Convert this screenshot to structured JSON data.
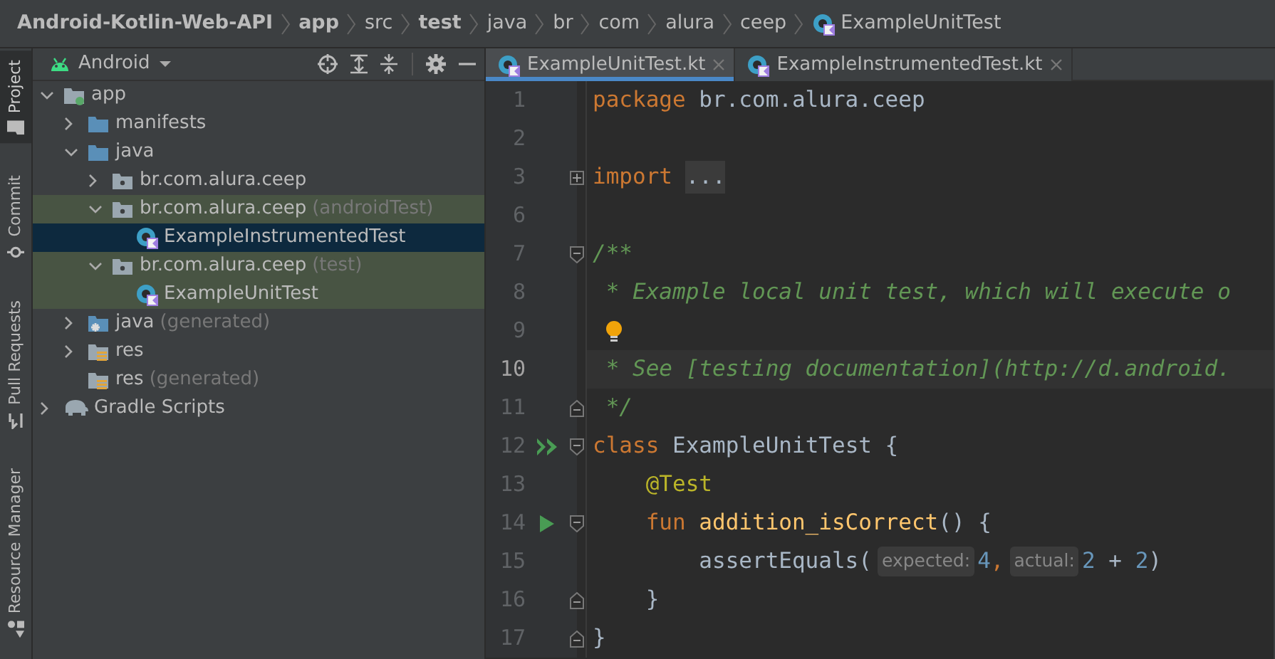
{
  "breadcrumbs": [
    {
      "text": "Android-Kotlin-Web-API",
      "kind": "module"
    },
    {
      "text": "app",
      "kind": "module"
    },
    {
      "text": "src",
      "kind": "dir"
    },
    {
      "text": "test",
      "kind": "module"
    },
    {
      "text": "java",
      "kind": "dir"
    },
    {
      "text": "br",
      "kind": "dir"
    },
    {
      "text": "com",
      "kind": "dir"
    },
    {
      "text": "alura",
      "kind": "dir"
    },
    {
      "text": "ceep",
      "kind": "dir"
    },
    {
      "text": "ExampleUnitTest",
      "kind": "class"
    }
  ],
  "tool_strip": [
    {
      "label": "Project",
      "kind": "folder",
      "selected": true
    },
    {
      "label": "Commit",
      "kind": "commit",
      "selected": false
    },
    {
      "label": "Pull Requests",
      "kind": "pull",
      "selected": false
    },
    {
      "label": "Resource Manager",
      "kind": "resources",
      "selected": false
    }
  ],
  "project_panel": {
    "view": "Android",
    "tree": [
      {
        "label": "app",
        "kind": "module",
        "expanded": true,
        "selected": false,
        "scope_highlight": false,
        "children": [
          {
            "label": "manifests",
            "kind": "folder",
            "expanded": false,
            "selected": false,
            "scope_highlight": false
          },
          {
            "label": "java",
            "kind": "folder",
            "expanded": true,
            "selected": false,
            "scope_highlight": false,
            "children": [
              {
                "label": "br.com.alura.ceep",
                "kind": "package",
                "expanded": false,
                "selected": false,
                "scope_highlight": false
              },
              {
                "label": "br.com.alura.ceep",
                "note": "(androidTest)",
                "kind": "package",
                "expanded": true,
                "selected": false,
                "scope_highlight": true,
                "children": [
                  {
                    "label": "ExampleInstrumentedTest",
                    "kind": "class",
                    "selected": true
                  }
                ]
              },
              {
                "label": "br.com.alura.ceep",
                "note": "(test)",
                "kind": "package",
                "expanded": true,
                "selected": false,
                "scope_highlight": true,
                "children": [
                  {
                    "label": "ExampleUnitTest",
                    "kind": "class",
                    "selected": false,
                    "scope_highlight": true
                  }
                ]
              }
            ]
          },
          {
            "label": "java",
            "note": "(generated)",
            "kind": "generated",
            "expanded": false,
            "selected": false,
            "scope_highlight": false
          },
          {
            "label": "res",
            "kind": "res",
            "expanded": false,
            "selected": false,
            "scope_highlight": false
          },
          {
            "label": "res",
            "note": "(generated)",
            "kind": "res",
            "selected": false,
            "scope_highlight": false
          }
        ]
      },
      {
        "label": "Gradle Scripts",
        "kind": "gradle",
        "expanded": false,
        "selected": false,
        "scope_highlight": false
      }
    ]
  },
  "editor_tabs": [
    {
      "label": "ExampleUnitTest.kt",
      "selected": true
    },
    {
      "label": "ExampleInstrumentedTest.kt",
      "selected": false
    }
  ],
  "code_lines": [
    {
      "number": "1",
      "highlighted": false,
      "bulb": false,
      "tokens": [
        {
          "kind": "keyword",
          "text": "package "
        },
        {
          "kind": "plain",
          "text": "br.com.alura.ceep"
        }
      ]
    },
    {
      "number": "2",
      "highlighted": false,
      "bulb": false
    },
    {
      "number": "3",
      "highlighted": false,
      "bulb": false,
      "fold_marker": {
        "kind": "folded"
      },
      "tokens": [
        {
          "kind": "keyword",
          "text": "import "
        },
        {
          "kind": "folded",
          "text": "..."
        }
      ]
    },
    {
      "number": "6",
      "highlighted": false,
      "bulb": false
    },
    {
      "number": "7",
      "highlighted": false,
      "bulb": false,
      "fold_marker": {
        "kind": "start"
      },
      "tokens": [
        {
          "kind": "comment",
          "text": "/**"
        }
      ]
    },
    {
      "number": "8",
      "highlighted": false,
      "bulb": false,
      "tokens": [
        {
          "kind": "comment",
          "text": " * Example local unit test, which will execute o"
        }
      ]
    },
    {
      "number": "9",
      "highlighted": false,
      "bulb": true
    },
    {
      "number": "10",
      "highlighted": true,
      "bulb": false,
      "tokens": [
        {
          "kind": "comment",
          "text": " * See [testing documentation](http://d.android."
        }
      ]
    },
    {
      "number": "11",
      "highlighted": false,
      "bulb": false,
      "fold_marker": {
        "kind": "end"
      },
      "tokens": [
        {
          "kind": "comment",
          "text": " */"
        }
      ]
    },
    {
      "number": "12",
      "highlighted": false,
      "bulb": false,
      "run_marker": {
        "kind": "run_all"
      },
      "fold_marker": {
        "kind": "start"
      },
      "tokens": [
        {
          "kind": "keyword",
          "text": "class "
        },
        {
          "kind": "plain",
          "text": "ExampleUnitTest {"
        }
      ]
    },
    {
      "number": "13",
      "highlighted": false,
      "bulb": false,
      "tokens": [
        {
          "kind": "annotation",
          "text": "    @Test"
        }
      ]
    },
    {
      "number": "14",
      "highlighted": false,
      "bulb": false,
      "run_marker": {
        "kind": "run"
      },
      "fold_marker": {
        "kind": "start"
      },
      "tokens": [
        {
          "kind": "keyword",
          "text": "    fun "
        },
        {
          "kind": "function",
          "text": "addition_isCorrect"
        },
        {
          "kind": "plain",
          "text": "() {"
        }
      ]
    },
    {
      "number": "15",
      "highlighted": false,
      "bulb": false,
      "tokens": [
        {
          "kind": "plain",
          "text": "        assertEquals("
        },
        {
          "kind": "hint",
          "text": "expected:"
        },
        {
          "kind": "number",
          "text": "4"
        },
        {
          "kind": "keyword",
          "text": ","
        },
        {
          "kind": "hint",
          "text": "actual:"
        },
        {
          "kind": "number",
          "text": "2"
        },
        {
          "kind": "plain",
          "text": " + "
        },
        {
          "kind": "number",
          "text": "2"
        },
        {
          "kind": "plain",
          "text": ")"
        }
      ]
    },
    {
      "number": "16",
      "highlighted": false,
      "bulb": false,
      "fold_marker": {
        "kind": "end"
      },
      "tokens": [
        {
          "kind": "plain",
          "text": "    }"
        }
      ]
    },
    {
      "number": "17",
      "highlighted": false,
      "bulb": false,
      "fold_marker": {
        "kind": "end"
      },
      "tokens": [
        {
          "kind": "plain",
          "text": "}"
        }
      ]
    }
  ]
}
